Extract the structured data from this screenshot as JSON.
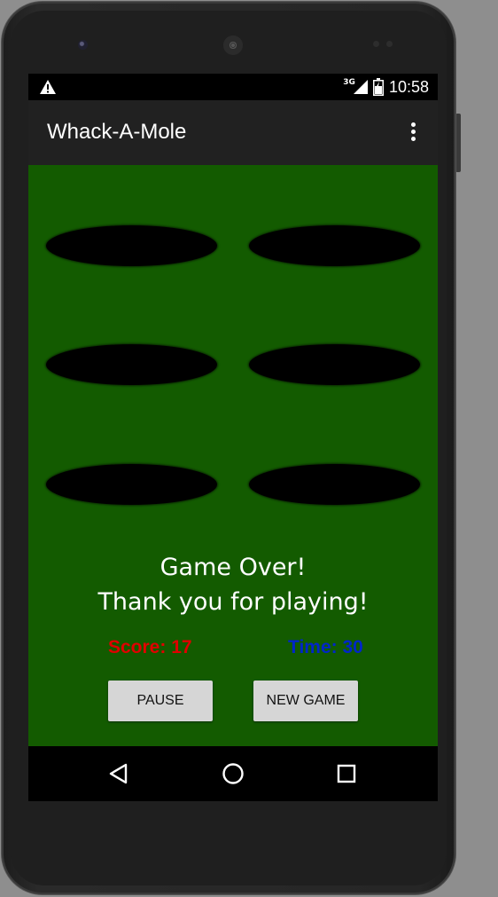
{
  "status_bar": {
    "network_label": "3G",
    "time": "10:58",
    "icons": [
      "warning-icon",
      "signal-icon",
      "battery-icon"
    ]
  },
  "app_bar": {
    "title": "Whack-A-Mole",
    "menu_icon": "overflow-menu-icon"
  },
  "game": {
    "background_color": "#135b00",
    "hole_color": "#000000",
    "holes": 6,
    "message_line1": "Game Over!",
    "message_line2": "Thank you for playing!",
    "score_text": "Score: 17",
    "score_color": "#e00000",
    "time_text": "Time: 30",
    "time_color": "#0026c8",
    "pause_label": "PAUSE",
    "new_game_label": "NEW GAME"
  },
  "nav_bar": {
    "buttons": [
      "back-icon",
      "home-icon",
      "recents-icon"
    ]
  }
}
